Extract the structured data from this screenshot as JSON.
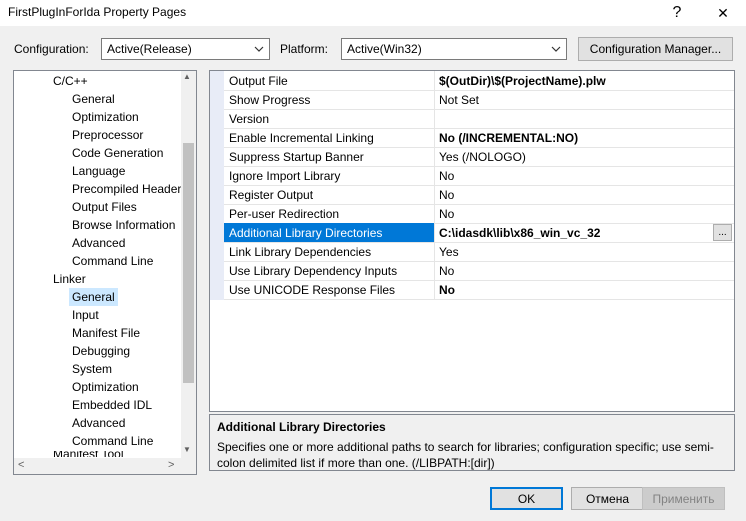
{
  "window": {
    "title": "FirstPlugInForIda Property Pages",
    "help_glyph": "?",
    "close_glyph": "✕"
  },
  "config": {
    "configuration_label": "Configuration:",
    "configuration_value": "Active(Release)",
    "platform_label": "Platform:",
    "platform_value": "Active(Win32)",
    "manager_button": "Configuration Manager..."
  },
  "tree": {
    "items": [
      {
        "label": "C/C++"
      },
      {
        "label": "General"
      },
      {
        "label": "Optimization"
      },
      {
        "label": "Preprocessor"
      },
      {
        "label": "Code Generation"
      },
      {
        "label": "Language"
      },
      {
        "label": "Precompiled Header"
      },
      {
        "label": "Output Files"
      },
      {
        "label": "Browse Information"
      },
      {
        "label": "Advanced"
      },
      {
        "label": "Command Line"
      },
      {
        "label": "Linker"
      },
      {
        "label": "General"
      },
      {
        "label": "Input"
      },
      {
        "label": "Manifest File"
      },
      {
        "label": "Debugging"
      },
      {
        "label": "System"
      },
      {
        "label": "Optimization"
      },
      {
        "label": "Embedded IDL"
      },
      {
        "label": "Advanced"
      },
      {
        "label": "Command Line"
      },
      {
        "label": "Manifest Tool"
      }
    ],
    "scroll_up": "▲",
    "scroll_down": "▼",
    "scroll_left": "<",
    "scroll_right": ">"
  },
  "properties": {
    "rows": [
      {
        "name": "Output File",
        "value": "$(OutDir)\\$(ProjectName).plw"
      },
      {
        "name": "Show Progress",
        "value": "Not Set"
      },
      {
        "name": "Version",
        "value": ""
      },
      {
        "name": "Enable Incremental Linking",
        "value": "No (/INCREMENTAL:NO)"
      },
      {
        "name": "Suppress Startup Banner",
        "value": "Yes (/NOLOGO)"
      },
      {
        "name": "Ignore Import Library",
        "value": "No"
      },
      {
        "name": "Register Output",
        "value": "No"
      },
      {
        "name": "Per-user Redirection",
        "value": "No"
      },
      {
        "name": "Additional Library Directories",
        "value": "C:\\idasdk\\lib\\x86_win_vc_32"
      },
      {
        "name": "Link Library Dependencies",
        "value": "Yes"
      },
      {
        "name": "Use Library Dependency Inputs",
        "value": "No"
      },
      {
        "name": "Use UNICODE Response Files",
        "value": "No"
      }
    ],
    "ellipsis": "..."
  },
  "description": {
    "title": "Additional Library Directories",
    "text": "Specifies one or more additional paths to search for libraries; configuration specific; use semi-colon delimited list if more than one.    (/LIBPATH:[dir])"
  },
  "buttons": {
    "ok": "OK",
    "cancel": "Отмена",
    "apply": "Применить"
  },
  "colors": {
    "selection": "#0078d7",
    "tree_selection": "#cce8ff"
  }
}
